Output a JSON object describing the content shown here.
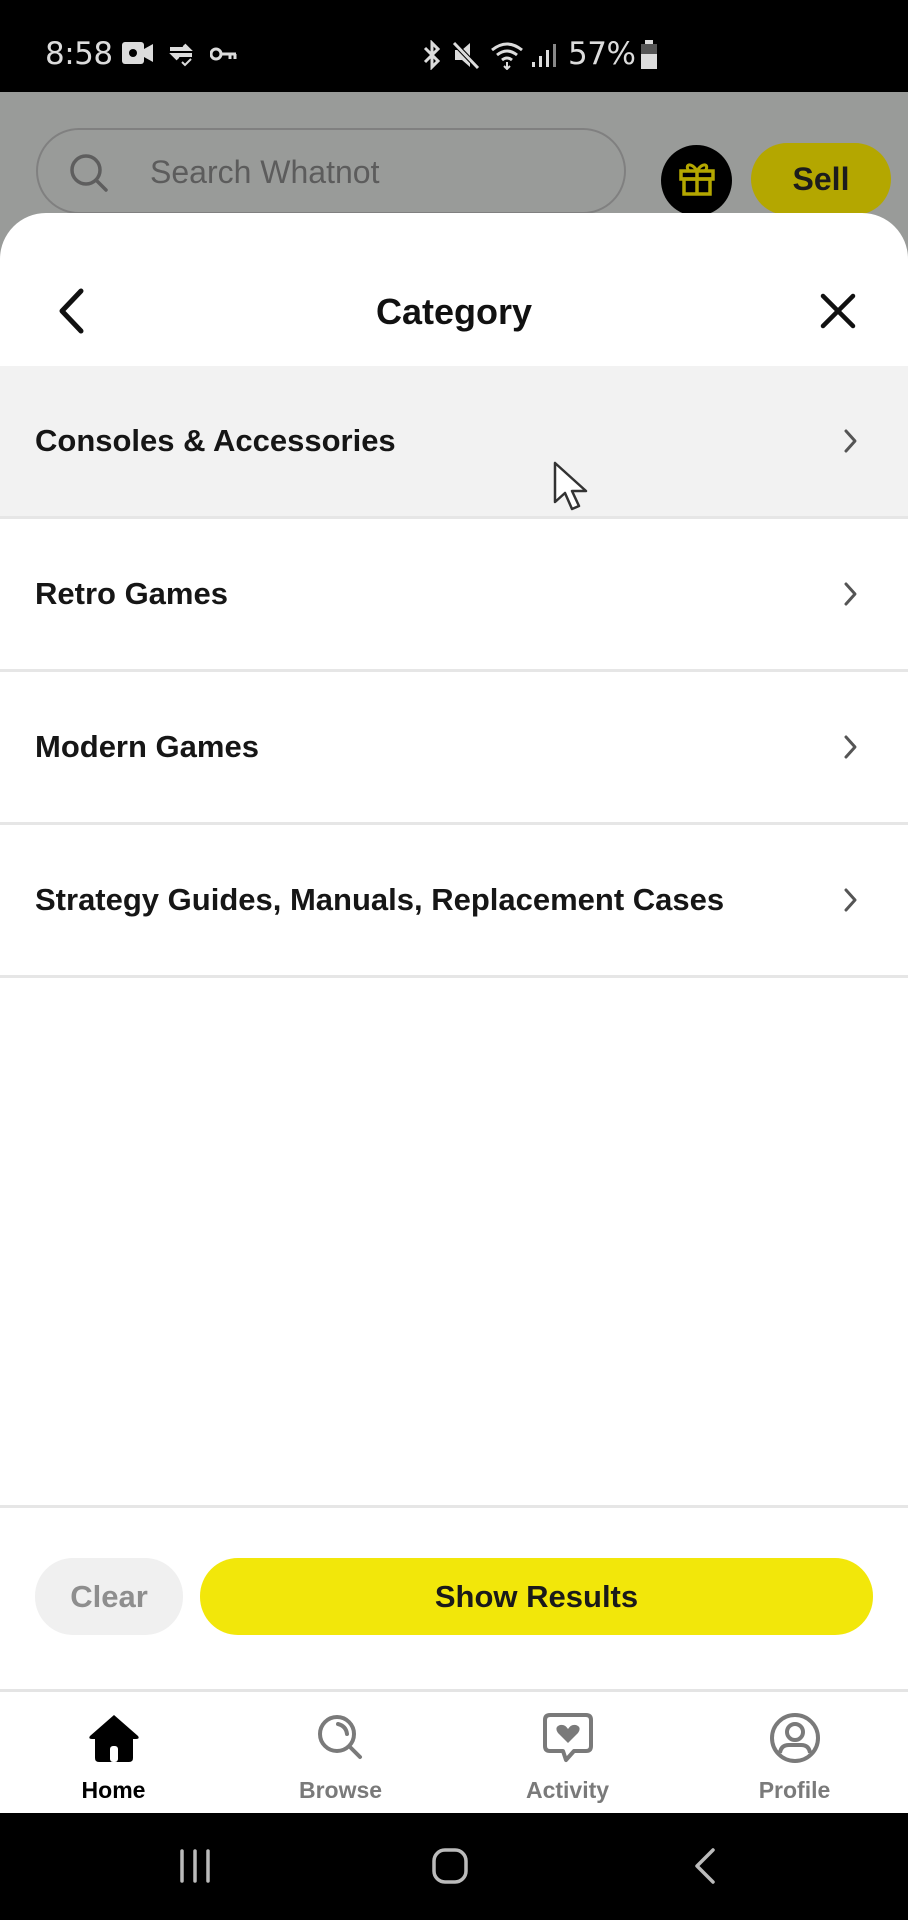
{
  "status_bar": {
    "time": "8:58",
    "battery_percent": "57%",
    "left_icons": [
      "video-camera-icon",
      "sync-check-icon",
      "key-icon"
    ],
    "right_icons": [
      "bluetooth-icon",
      "mute-icon",
      "wifi-icon",
      "signal-icon",
      "battery-icon"
    ]
  },
  "app_header": {
    "search_placeholder": "Search Whatnot",
    "gift_icon": "gift-icon",
    "sell_label": "Sell"
  },
  "sheet": {
    "title": "Category",
    "back_icon": "chevron-left-icon",
    "close_icon": "close-icon",
    "categories": [
      {
        "label": "Consoles & Accessories",
        "highlighted": true
      },
      {
        "label": "Retro Games",
        "highlighted": false
      },
      {
        "label": "Modern Games",
        "highlighted": false
      },
      {
        "label": "Strategy Guides, Manuals, Replacement Cases",
        "highlighted": false
      }
    ],
    "clear_label": "Clear",
    "show_results_label": "Show Results"
  },
  "bottom_nav": {
    "items": [
      {
        "label": "Home",
        "icon": "home-icon",
        "active": true
      },
      {
        "label": "Browse",
        "icon": "browse-icon",
        "active": false
      },
      {
        "label": "Activity",
        "icon": "activity-icon",
        "active": false
      },
      {
        "label": "Profile",
        "icon": "profile-icon",
        "active": false
      }
    ]
  },
  "system_nav": {
    "buttons": [
      "recents-icon",
      "home-circle-icon",
      "back-icon"
    ]
  },
  "colors": {
    "accent_yellow": "#f2e70a",
    "sell_dimmed": "#b4a700",
    "overlay": "#999b99",
    "highlight_row": "#f2f2f2"
  }
}
